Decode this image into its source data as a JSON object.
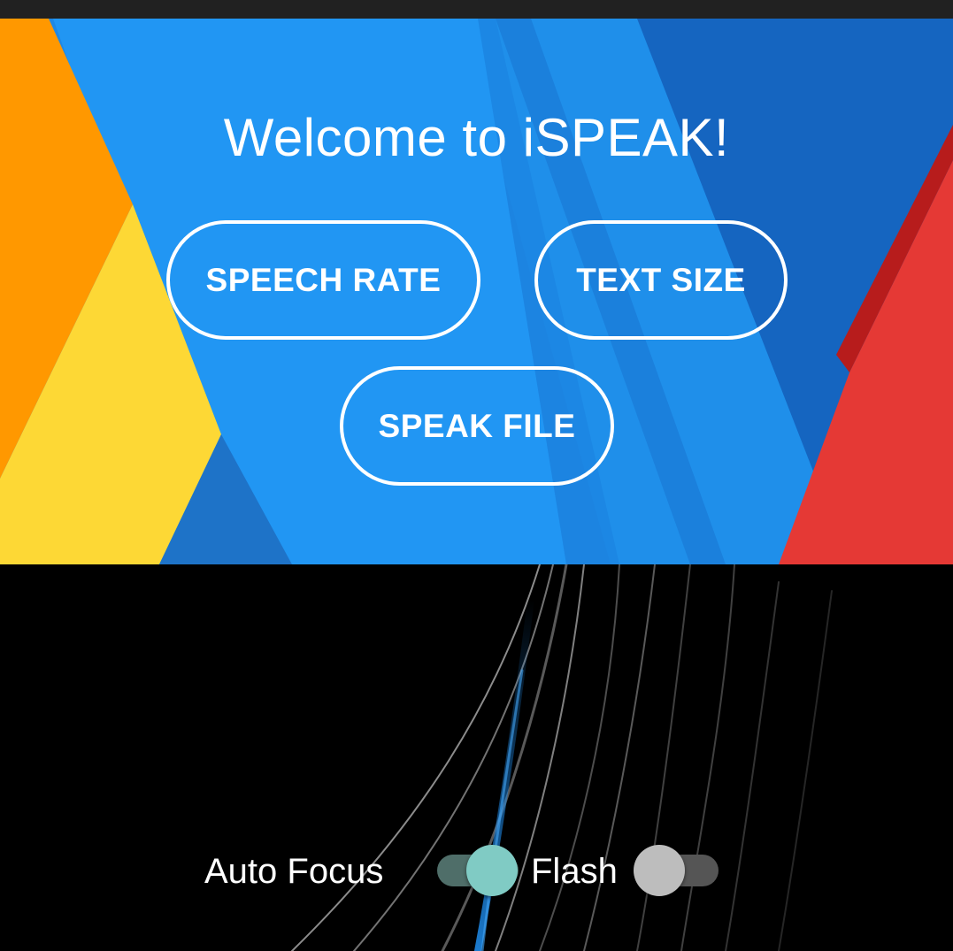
{
  "header": {
    "title": "Welcome to iSPEAK!"
  },
  "buttons": {
    "speech_rate": "SPEECH RATE",
    "text_size": "TEXT SIZE",
    "speak_file": "SPEAK FILE"
  },
  "controls": {
    "auto_focus": {
      "label": "Auto Focus",
      "on": true
    },
    "flash": {
      "label": "Flash",
      "on": false
    }
  },
  "colors": {
    "wallpaper_blue": "#2196f3",
    "wallpaper_dark_blue": "#1565c0",
    "wallpaper_orange": "#ff9800",
    "wallpaper_yellow": "#fdd835",
    "wallpaper_red": "#e53935",
    "switch_on_thumb": "#80cbc4",
    "switch_off_thumb": "#bdbdbd"
  }
}
